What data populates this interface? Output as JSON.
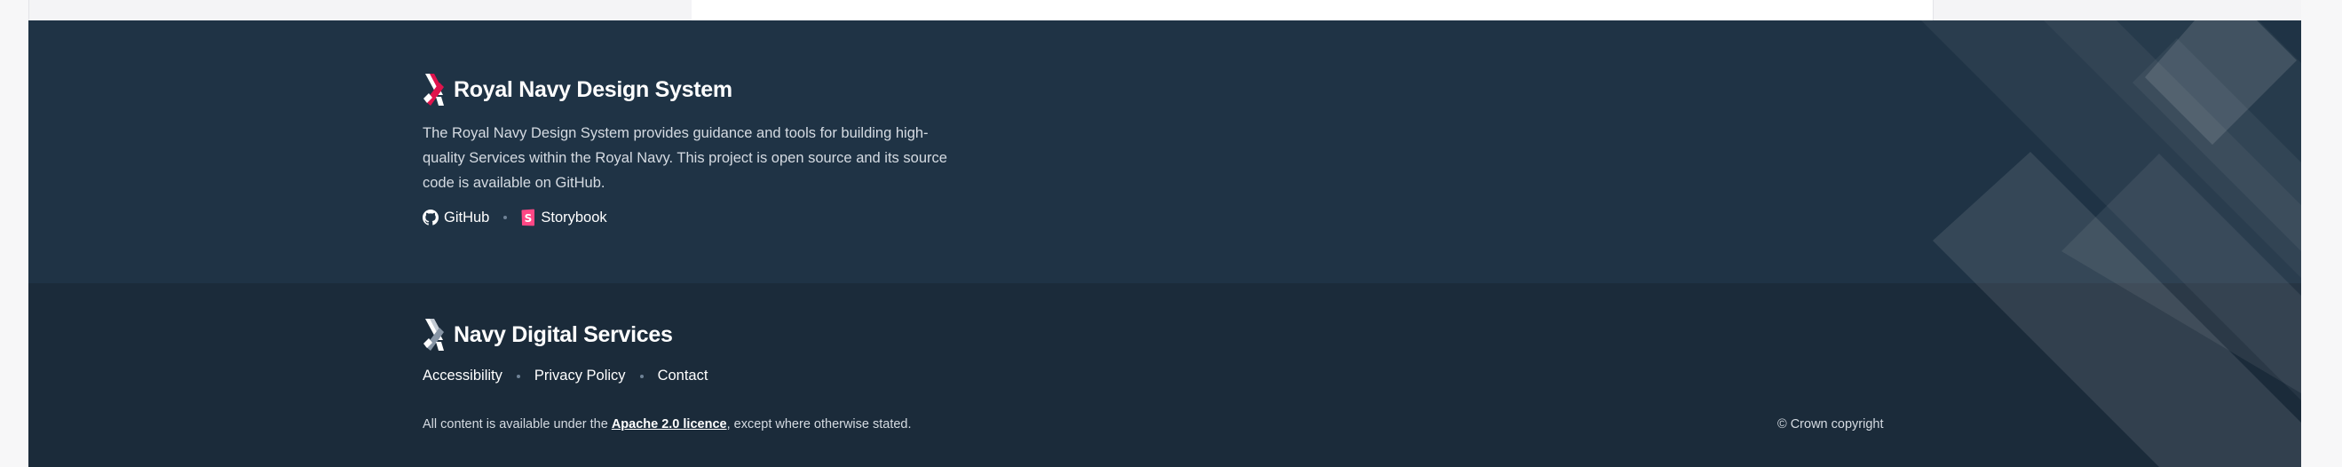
{
  "colors": {
    "footer_top": "#1f3345",
    "footer_bottom": "#1b2b3a",
    "brand_accent": "#e0134c",
    "storybook_pink": "#ff4785"
  },
  "footer": {
    "primary": {
      "logo_icon": "royal-navy-logo-icon",
      "title": "Royal Navy Design System",
      "description": "The Royal Navy Design System provides guidance and tools for building high-quality Services within the Royal Navy. This project is open source and its source code is available on GitHub.",
      "links": [
        {
          "label": "GitHub",
          "icon": "github-icon"
        },
        {
          "label": "Storybook",
          "icon": "storybook-icon"
        }
      ]
    },
    "secondary": {
      "logo_icon": "navy-digital-logo-icon",
      "title": "Navy Digital Services",
      "links": [
        {
          "label": "Accessibility"
        },
        {
          "label": "Privacy Policy"
        },
        {
          "label": "Contact"
        }
      ],
      "licence": {
        "prefix": "All content is available under the ",
        "link": "Apache 2.0 licence",
        "suffix": ", except where otherwise stated."
      },
      "copyright": "© Crown copyright"
    }
  }
}
